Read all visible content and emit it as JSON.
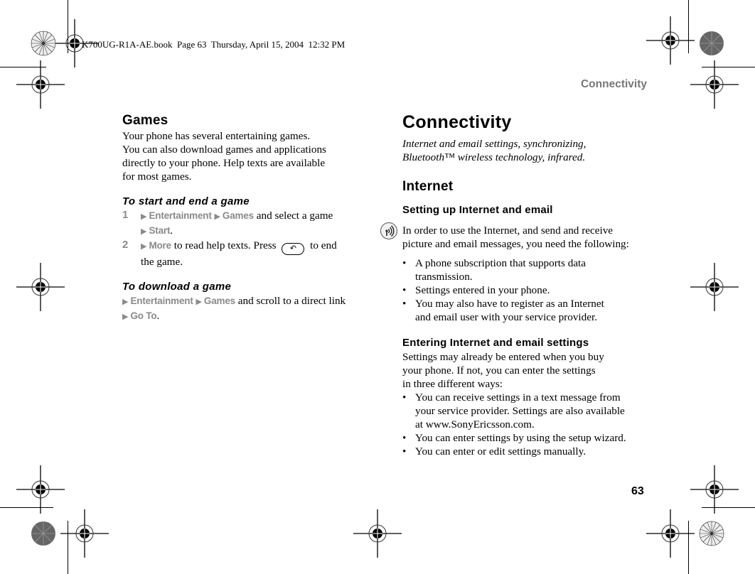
{
  "print_marks": {
    "book_info": "K700UG-R1A-AE.book  Page 63  Thursday, April 15, 2004  12:32 PM"
  },
  "running_head": "Connectivity",
  "page_number": "63",
  "left_column": {
    "heading": "Games",
    "intro": [
      "Your phone has several entertaining games.",
      "You can also download games and applications",
      "directly to your phone. Help texts are available",
      "for most games."
    ],
    "start_end": {
      "heading": "To start and end a game",
      "steps": [
        {
          "num": "1",
          "menu1": "Entertainment",
          "menu2": "Games",
          "text": " and select a game",
          "menu3": "Start",
          "end": "."
        },
        {
          "num": "2",
          "menu1": "More",
          "text": " to read help texts. Press",
          "key_icon": "back-key-icon",
          "text2": " to end",
          "text3": "the game."
        }
      ]
    },
    "download": {
      "heading": "To download a game",
      "menu1": "Entertainment",
      "menu2": "Games",
      "text": " and scroll to a direct link",
      "menu3": "Go To",
      "end": "."
    }
  },
  "right_column": {
    "chapter_title": "Connectivity",
    "chapter_intro": [
      "Internet and email settings, synchronizing,",
      "Bluetooth™ wireless technology, infrared."
    ],
    "section": "Internet",
    "setup": {
      "heading": "Setting up Internet and email",
      "note_icon": "operator-service-icon",
      "note": [
        "In order to use the Internet, and send and receive",
        "picture and email messages, you need the following:"
      ],
      "bullets": [
        [
          "A phone subscription that supports data",
          "transmission."
        ],
        [
          "Settings entered in your phone."
        ],
        [
          "You may also have to register as an Internet",
          "and email user with your service provider."
        ]
      ]
    },
    "entering": {
      "heading": "Entering Internet and email settings",
      "intro": [
        "Settings may already be entered when you buy",
        "your phone. If not, you can enter the settings",
        "in three different ways:"
      ],
      "bullets": [
        [
          "You can receive settings in a text message from",
          "your service provider. Settings are also available",
          "at www.SonyEricsson.com."
        ],
        [
          "You can enter settings by using the setup wizard."
        ],
        [
          "You can enter or edit settings manually."
        ]
      ]
    }
  },
  "colors": {
    "menu_gray": "#8a8a8a",
    "running_head_gray": "#777777"
  }
}
